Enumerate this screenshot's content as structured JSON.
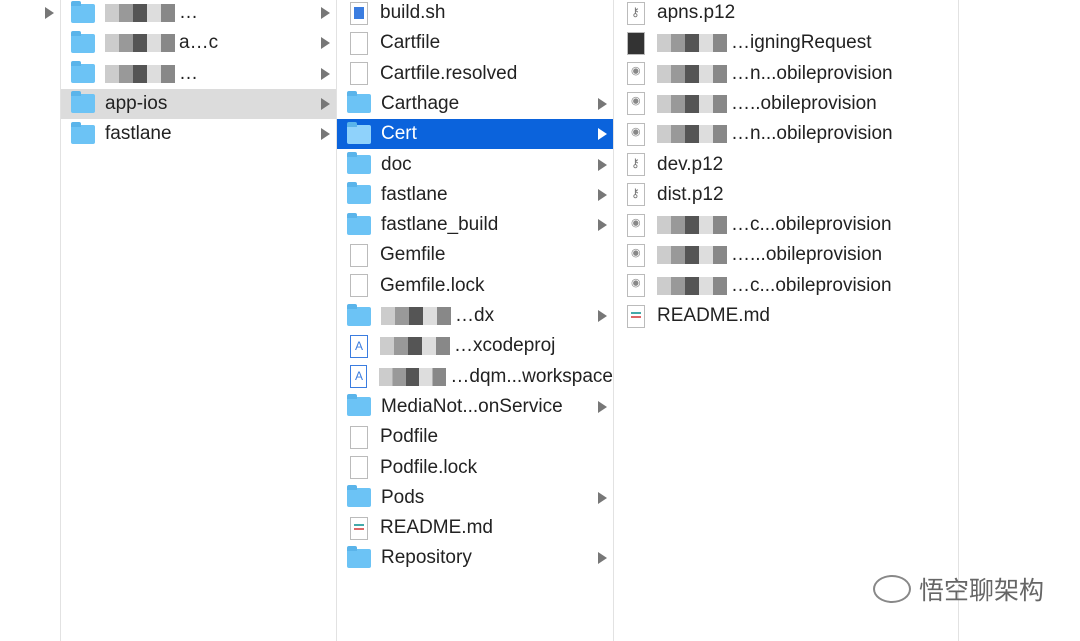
{
  "col1": {
    "rows": [
      {
        "arrow": true
      }
    ]
  },
  "col2": {
    "rows": [
      {
        "label": "…",
        "redacted": true
      },
      {
        "label": "a…c",
        "redacted": true
      },
      {
        "label": "…",
        "redacted": true
      },
      {
        "label": "app-ios",
        "selected": true
      },
      {
        "label": "fastlane"
      }
    ]
  },
  "col3": {
    "rows": [
      {
        "label": "build.sh",
        "icon": "sh"
      },
      {
        "label": "Cartfile",
        "icon": "doc"
      },
      {
        "label": "Cartfile.resolved",
        "icon": "doc"
      },
      {
        "label": "Carthage",
        "icon": "folder",
        "arrow": true
      },
      {
        "label": "Cert",
        "icon": "folder",
        "arrow": true,
        "active": true
      },
      {
        "label": "doc",
        "icon": "folder",
        "arrow": true
      },
      {
        "label": "fastlane",
        "icon": "folder",
        "arrow": true
      },
      {
        "label": "fastlane_build",
        "icon": "folder",
        "arrow": true
      },
      {
        "label": "Gemfile",
        "icon": "doc"
      },
      {
        "label": "Gemfile.lock",
        "icon": "doc"
      },
      {
        "label": "…dx",
        "icon": "folder",
        "arrow": true,
        "redacted": true
      },
      {
        "label": "…xcodeproj",
        "icon": "xc",
        "redacted": true
      },
      {
        "label": "…dqm...workspace",
        "icon": "xc",
        "redacted": true
      },
      {
        "label": "MediaNot...onService",
        "icon": "folder",
        "arrow": true
      },
      {
        "label": "Podfile",
        "icon": "doc"
      },
      {
        "label": "Podfile.lock",
        "icon": "doc"
      },
      {
        "label": "Pods",
        "icon": "folder",
        "arrow": true
      },
      {
        "label": "README.md",
        "icon": "md"
      },
      {
        "label": "Repository",
        "icon": "folder",
        "arrow": true
      }
    ]
  },
  "col4": {
    "rows": [
      {
        "label": "apns.p12",
        "icon": "key"
      },
      {
        "label": "…igningRequest",
        "icon": "csr",
        "redacted": true
      },
      {
        "label": "…n...obileprovision",
        "icon": "prov",
        "redacted": true
      },
      {
        "label": "…..obileprovision",
        "icon": "prov",
        "redacted": true
      },
      {
        "label": "…n...obileprovision",
        "icon": "prov",
        "redacted": true
      },
      {
        "label": "dev.p12",
        "icon": "key"
      },
      {
        "label": "dist.p12",
        "icon": "key"
      },
      {
        "label": "…c...obileprovision",
        "icon": "prov",
        "redacted": true
      },
      {
        "label": "…...obileprovision",
        "icon": "prov",
        "redacted": true
      },
      {
        "label": "…c...obileprovision",
        "icon": "prov",
        "redacted": true
      },
      {
        "label": "README.md",
        "icon": "md"
      }
    ]
  },
  "watermark": {
    "text": "悟空聊架构"
  }
}
